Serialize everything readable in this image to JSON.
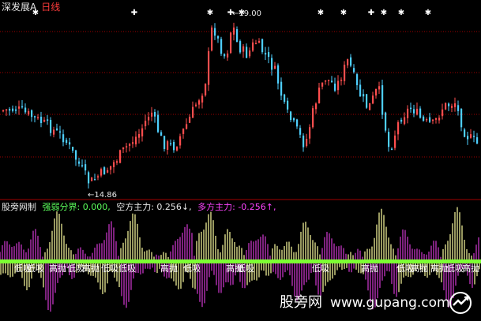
{
  "header": {
    "title": "深发展A",
    "period": "日线"
  },
  "price_pane": {
    "high_label": "←19.00",
    "low_label": "←14.86"
  },
  "indicator_pane": {
    "source": "股旁网制",
    "items": [
      {
        "text": "强弱分界: 0.000,",
        "color": "#5cff5c"
      },
      {
        "text": "空方主力: 0.256↓,",
        "color": "#e6e6e6"
      },
      {
        "text": "多方主力: -0.256↑,",
        "color": "#ff44ff"
      }
    ],
    "signal_high": "高抛",
    "signal_low": "低吸"
  },
  "watermark": {
    "name": "股旁网",
    "url": "www.gupang.com"
  },
  "colors": {
    "up": "#ff4e4e",
    "down": "#4ecfff",
    "bull_fill": "#d238d2",
    "bear_fill": "#ffffa0",
    "divider": "#a00000",
    "zero_line": "#7cff32"
  },
  "chart_data": [
    {
      "type": "candlestick",
      "title": "深发展A",
      "price_range": [
        14.86,
        19.0
      ],
      "high": 19.0,
      "low": 14.86
    },
    {
      "type": "area",
      "title": "股旁网制",
      "series": [
        {
          "name": "强弱分界",
          "value": 0.0
        },
        {
          "name": "空方主力",
          "value": 0.256
        },
        {
          "name": "多方主力",
          "value": -0.256
        }
      ]
    }
  ]
}
